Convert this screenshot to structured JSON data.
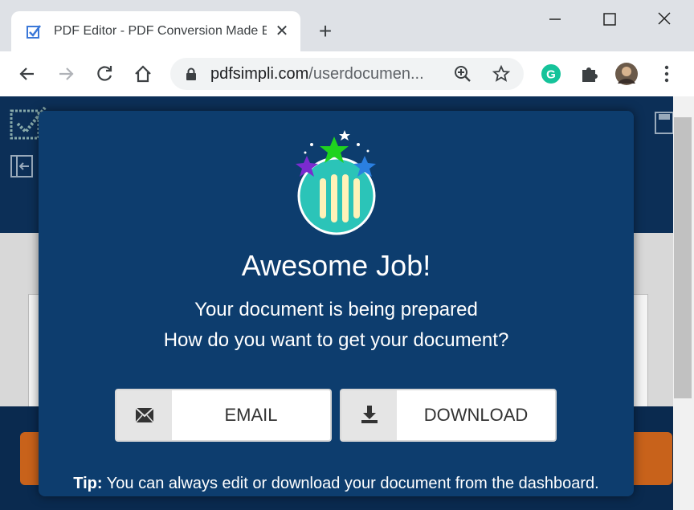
{
  "browser": {
    "tab_title": "PDF Editor - PDF Conversion Made Easy",
    "url_domain": "pdfsimpli.com",
    "url_path": "/userdocumen...",
    "extension_badge": "G"
  },
  "modal": {
    "heading": "Awesome Job!",
    "subtitle_line1": "Your document is being prepared",
    "subtitle_line2": "How do you want to get your document?",
    "email_label": "EMAIL",
    "download_label": "DOWNLOAD",
    "tip_bold": "Tip:",
    "tip_text": " You can always edit or download your document from the dashboard."
  },
  "colors": {
    "modal_bg": "#0d3d6e",
    "page_bg": "#0c2f57",
    "accent_teal": "#2bc4b8",
    "star_green": "#1fd31f",
    "star_purple": "#7b2bd0",
    "star_blue": "#2a7fe0",
    "grammarly_green": "#15c39a"
  }
}
